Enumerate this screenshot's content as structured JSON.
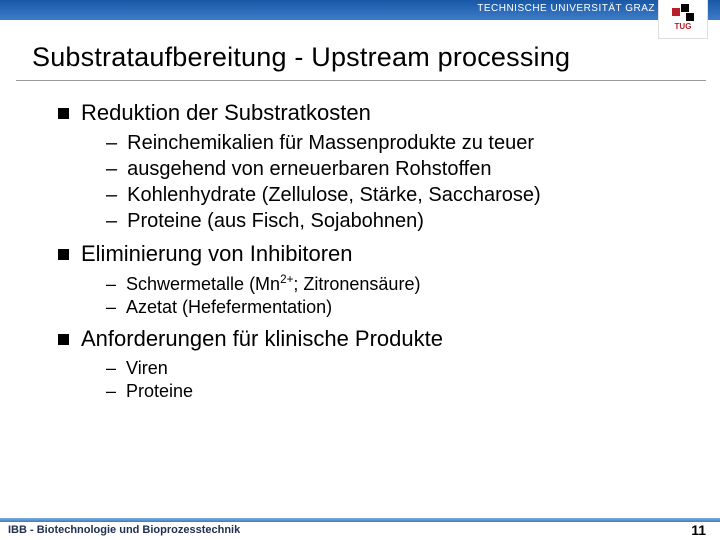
{
  "header": {
    "org": "TECHNISCHE UNIVERSITÄT GRAZ",
    "logo_label": "TUG"
  },
  "slide": {
    "title": "Substrataufbereitung - Upstream processing",
    "sections": [
      {
        "heading": "Reduktion der Substratkosten",
        "items": [
          "Reinchemikalien für Massenprodukte zu teuer",
          "ausgehend von erneuerbaren Rohstoffen",
          "Kohlenhydrate (Zellulose, Stärke, Saccharose)",
          "Proteine (aus Fisch, Sojabohnen)"
        ]
      },
      {
        "heading": "Eliminierung von Inhibitoren",
        "items": [
          {
            "pre": "Schwermetalle (Mn",
            "sup": "2+",
            "post": "; Zitronensäure)"
          },
          "Azetat (Hefefermentation)"
        ]
      },
      {
        "heading": "Anforderungen für klinische Produkte",
        "items": [
          "Viren",
          "Proteine"
        ]
      }
    ]
  },
  "footer": {
    "left": "IBB - Biotechnologie und Bioprozesstechnik",
    "page": "11"
  }
}
